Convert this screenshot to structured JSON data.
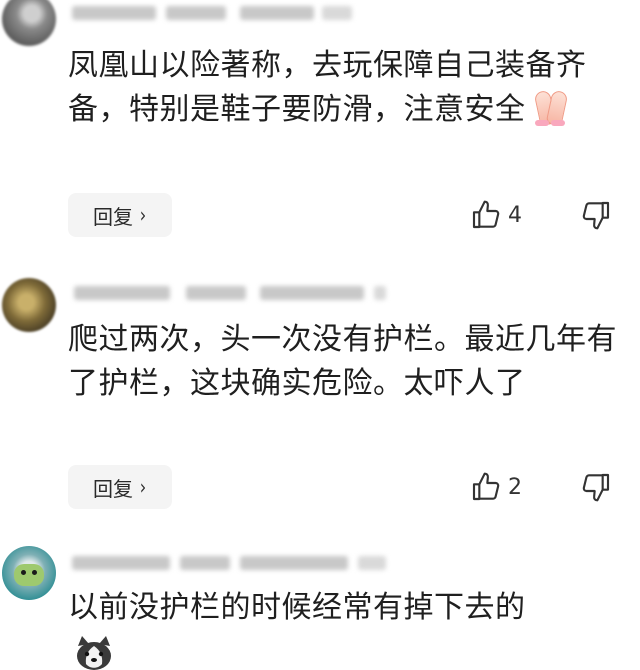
{
  "comments": [
    {
      "text": "凤凰山以险著称，去玩保障自己装备齐备，特别是鞋子要防滑，注意安全",
      "reply_label": "回复",
      "like_count": "4",
      "trailing_emoji": "praying-hands"
    },
    {
      "text": "爬过两次，头一次没有护栏。最近几年有了护栏，这块确实危险。太吓人了",
      "reply_label": "回复",
      "like_count": "2"
    },
    {
      "text": "以前没护栏的时候经常有掉下去的",
      "trailing_emoji": "dog-face"
    }
  ],
  "icons": {
    "like": "thumbs-up-outline-icon",
    "dislike": "thumbs-down-outline-icon",
    "reply_chevron": "chevron-right-icon"
  },
  "colors": {
    "text": "#1f1f1f",
    "reply_bg": "#f4f4f4",
    "icon_stroke": "#333333"
  }
}
